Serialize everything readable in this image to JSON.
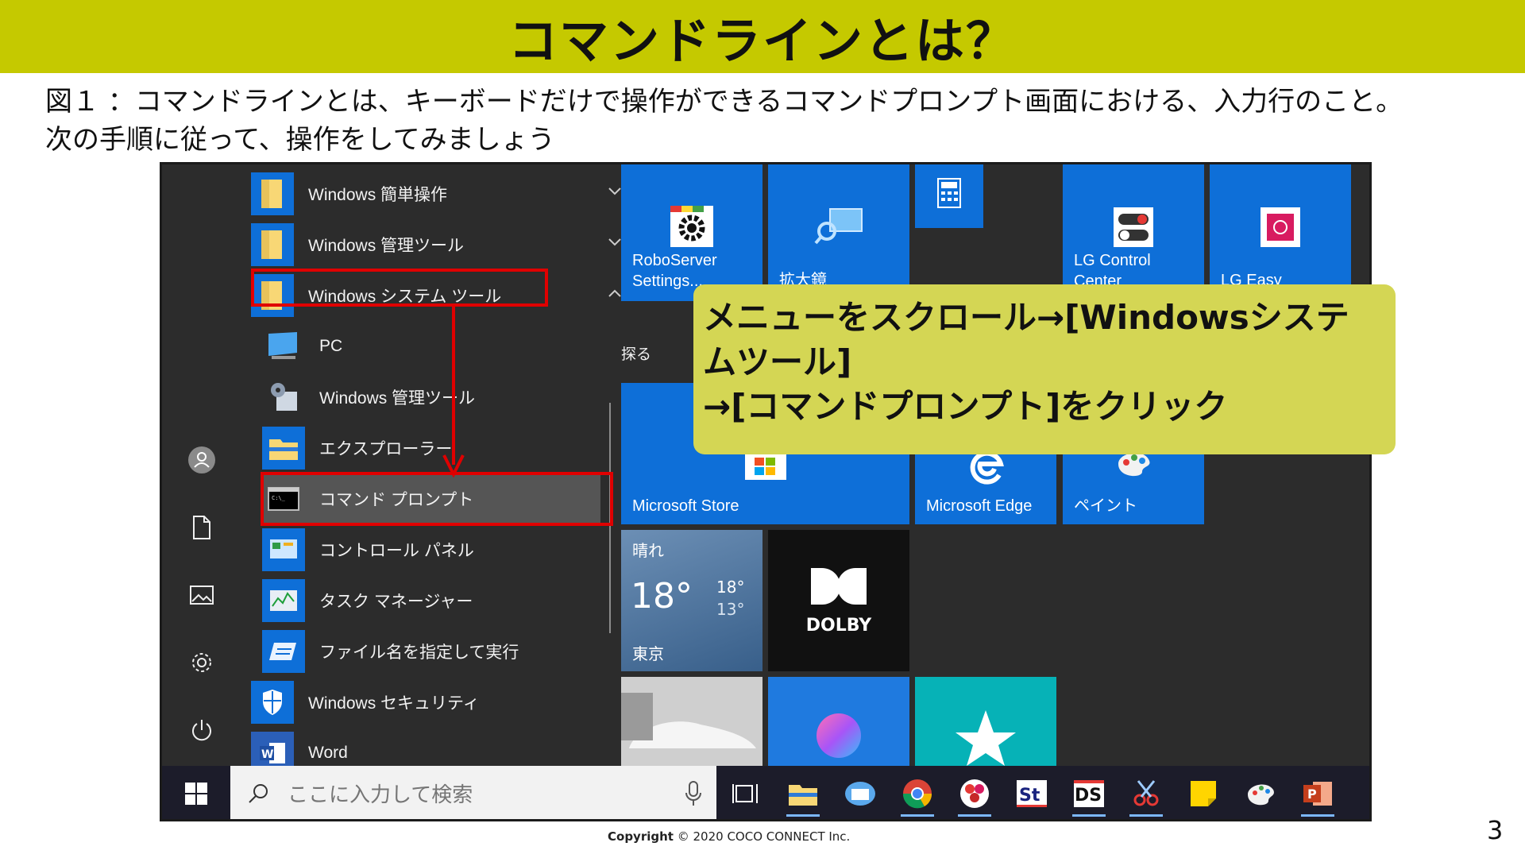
{
  "slide": {
    "title": "コマンドラインとは？",
    "description_line1": "図１ ：コマンドラインとは、キーボードだけで操作ができるコマンドプロンプト画面における、入力行のこと。",
    "description_line2": "次の手順に従って、操作をしてみましょう",
    "copyright_label": "Copyright",
    "copyright_text": " © 2020 COCO CONNECT Inc.",
    "page_number": "3",
    "accent_color": "#c5c900"
  },
  "callout": {
    "line1": "メニューをスクロール→[Windowsシステ",
    "line2": "ムツール]",
    "line3": "→[コマンドプロンプト]をクリック",
    "bg_color": "#d4d654"
  },
  "start_menu": {
    "apps": [
      {
        "label": "Windows 簡単操作",
        "icon": "folder-icon"
      },
      {
        "label": "Windows 管理ツール",
        "icon": "folder-icon"
      },
      {
        "label": "Windows システム ツール",
        "icon": "folder-icon"
      },
      {
        "label": "PC",
        "icon": "pc-icon"
      },
      {
        "label": "Windows 管理ツール",
        "icon": "admin-tools-icon"
      },
      {
        "label": "エクスプローラー",
        "icon": "explorer-icon"
      },
      {
        "label": "コマンド プロンプト",
        "icon": "cmd-icon"
      },
      {
        "label": "コントロール パネル",
        "icon": "control-panel-icon"
      },
      {
        "label": "タスク マネージャー",
        "icon": "task-manager-icon"
      },
      {
        "label": "ファイル名を指定して実行",
        "icon": "run-icon"
      },
      {
        "label": "Windows セキュリティ",
        "icon": "shield-icon"
      },
      {
        "label": "Word",
        "icon": "word-icon"
      }
    ],
    "section_title": "探る",
    "tiles": {
      "roboserver": "RoboServer Settings...",
      "magnifier": "拡大鏡",
      "lg_control": "LG Control Center",
      "lg_easy_guide": "LG Easy Guide",
      "store": "Microsoft Store",
      "edge": "Microsoft Edge",
      "paint": "ペイント",
      "weather_condition": "晴れ",
      "weather_temp": "18°",
      "weather_high": "18°",
      "weather_low": "13°",
      "weather_city": "東京",
      "dolby": "DOLBY"
    }
  },
  "taskbar": {
    "search_placeholder": "ここに入力して検索"
  }
}
